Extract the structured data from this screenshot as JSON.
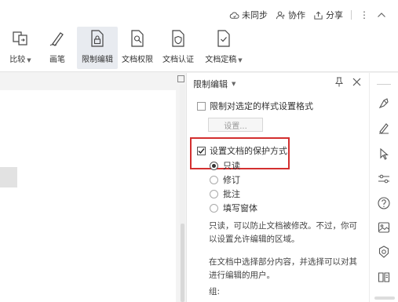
{
  "titlebar": {
    "sync_label": "未同步",
    "collab_label": "协作",
    "share_label": "分享",
    "more_label": "⋮"
  },
  "ribbon": {
    "compare_label": "比较",
    "pen_label": "画笔",
    "restrict_label": "限制编辑",
    "rights_label": "文档权限",
    "cert_label": "文档认证",
    "finalize_label": "文档定稿"
  },
  "panel": {
    "title": "限制编辑",
    "format_restrict_label": "限制对选定的样式设置格式",
    "settings_button": "设置...",
    "protect_label": "设置文档的保护方式",
    "protect_checked": true,
    "options": [
      {
        "label": "只读",
        "selected": true
      },
      {
        "label": "修订",
        "selected": false
      },
      {
        "label": "批注",
        "selected": false
      },
      {
        "label": "填写窗体",
        "selected": false
      }
    ],
    "desc1_line1": "只读，可以防止文档被修改。不过，你可",
    "desc1_line2": "以设置允许编辑的区域。",
    "desc2_line1": "在文档中选择部分内容，并选择可以对其",
    "desc2_line2": "进行编辑的用户。",
    "group_label": "组:"
  },
  "colors": {
    "highlight": "#d32f2f",
    "active_ribbon": "#e8ebf0"
  }
}
